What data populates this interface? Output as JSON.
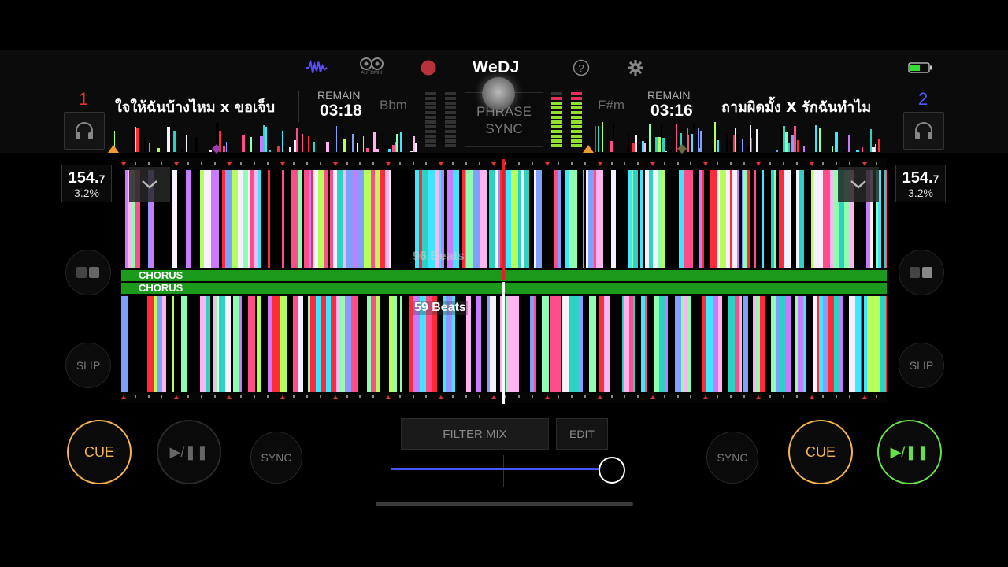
{
  "app": {
    "logo": "WeDJ",
    "automix_label": "AUTOMIX",
    "accent": "#5a4cff",
    "battery_color": "#33dd33"
  },
  "icons": [
    "waveform-icon",
    "automix-icon",
    "record-icon",
    "help-icon",
    "settings-icon",
    "battery-icon",
    "headphones-icon",
    "chevron-down-icon",
    "pad-mode-icon",
    "play-pause-icon"
  ],
  "deck1": {
    "number": "1",
    "number_color": "#e03030",
    "title": "ใจให้ฉันบ้างไหม x ขอเจ็บ",
    "remain_label": "REMAIN",
    "remain_time": "03:18",
    "key": "Bbm",
    "bpm": "154.",
    "bpm_decimal": "7",
    "pitch": "3.2%",
    "slip": "SLIP",
    "cue": "CUE",
    "play": "▶/❚❚",
    "sync": "SYNC"
  },
  "deck2": {
    "number": "2",
    "number_color": "#4a5aff",
    "title": "ถามผิดมั้ง X รักฉันทำไม",
    "remain_label": "REMAIN",
    "remain_time": "03:16",
    "key": "F#m",
    "bpm": "154.",
    "bpm_decimal": "7",
    "pitch": "3.2%",
    "slip": "SLIP",
    "cue": "CUE",
    "play": "▶/❚❚",
    "sync": "SYNC"
  },
  "center": {
    "phrase_line1": "PHRASE",
    "phrase_line2": "SYNC",
    "filter_mix": "FILTER MIX",
    "edit": "EDIT",
    "crossfader_position": 0.98
  },
  "waveform": {
    "top_beats": "96 Beats",
    "bottom_beats": "59 Beats",
    "section_top": "CHORUS",
    "section_bottom": "CHORUS",
    "section_color": "#1b9a1b",
    "palette": [
      "#ff4d8a",
      "#3fe6ff",
      "#8effb0",
      "#f6f0ff",
      "#c97bff",
      "#2ad3c2",
      "#b6ff5a",
      "#ff2b3a",
      "#ffb3f0",
      "#7fa0ff"
    ]
  }
}
